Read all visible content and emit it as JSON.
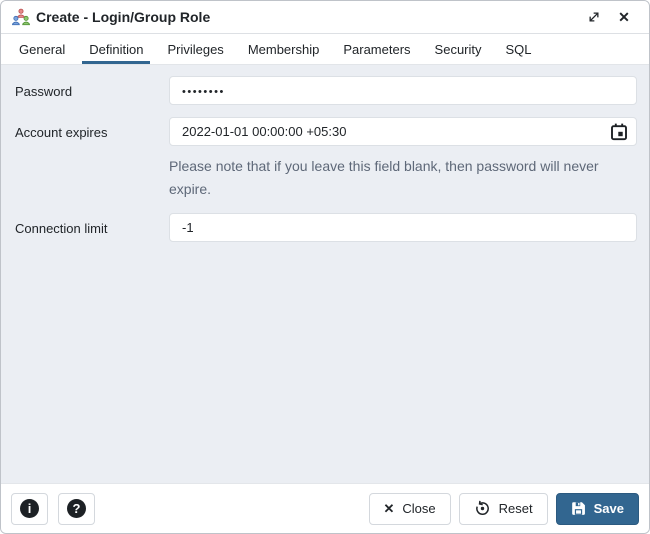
{
  "window": {
    "title": "Create - Login/Group Role"
  },
  "icons": {
    "window_close_glyph": "✕",
    "close_button_glyph": "✕",
    "info_glyph": "i",
    "help_glyph": "?"
  },
  "tabs": [
    {
      "label": "General"
    },
    {
      "label": "Definition"
    },
    {
      "label": "Privileges"
    },
    {
      "label": "Membership"
    },
    {
      "label": "Parameters"
    },
    {
      "label": "Security"
    },
    {
      "label": "SQL"
    }
  ],
  "form": {
    "password": {
      "label": "Password",
      "value": "••••••••"
    },
    "account_expires": {
      "label": "Account expires",
      "value": "2022-01-01 00:00:00 +05:30",
      "note": "Please note that if you leave this field blank, then password will never expire."
    },
    "connection_limit": {
      "label": "Connection limit",
      "value": "-1"
    }
  },
  "footer": {
    "close_label": "Close",
    "reset_label": "Reset",
    "save_label": "Save"
  },
  "colors": {
    "accent_blue": "#326690",
    "content_bg": "#ebeef3"
  }
}
